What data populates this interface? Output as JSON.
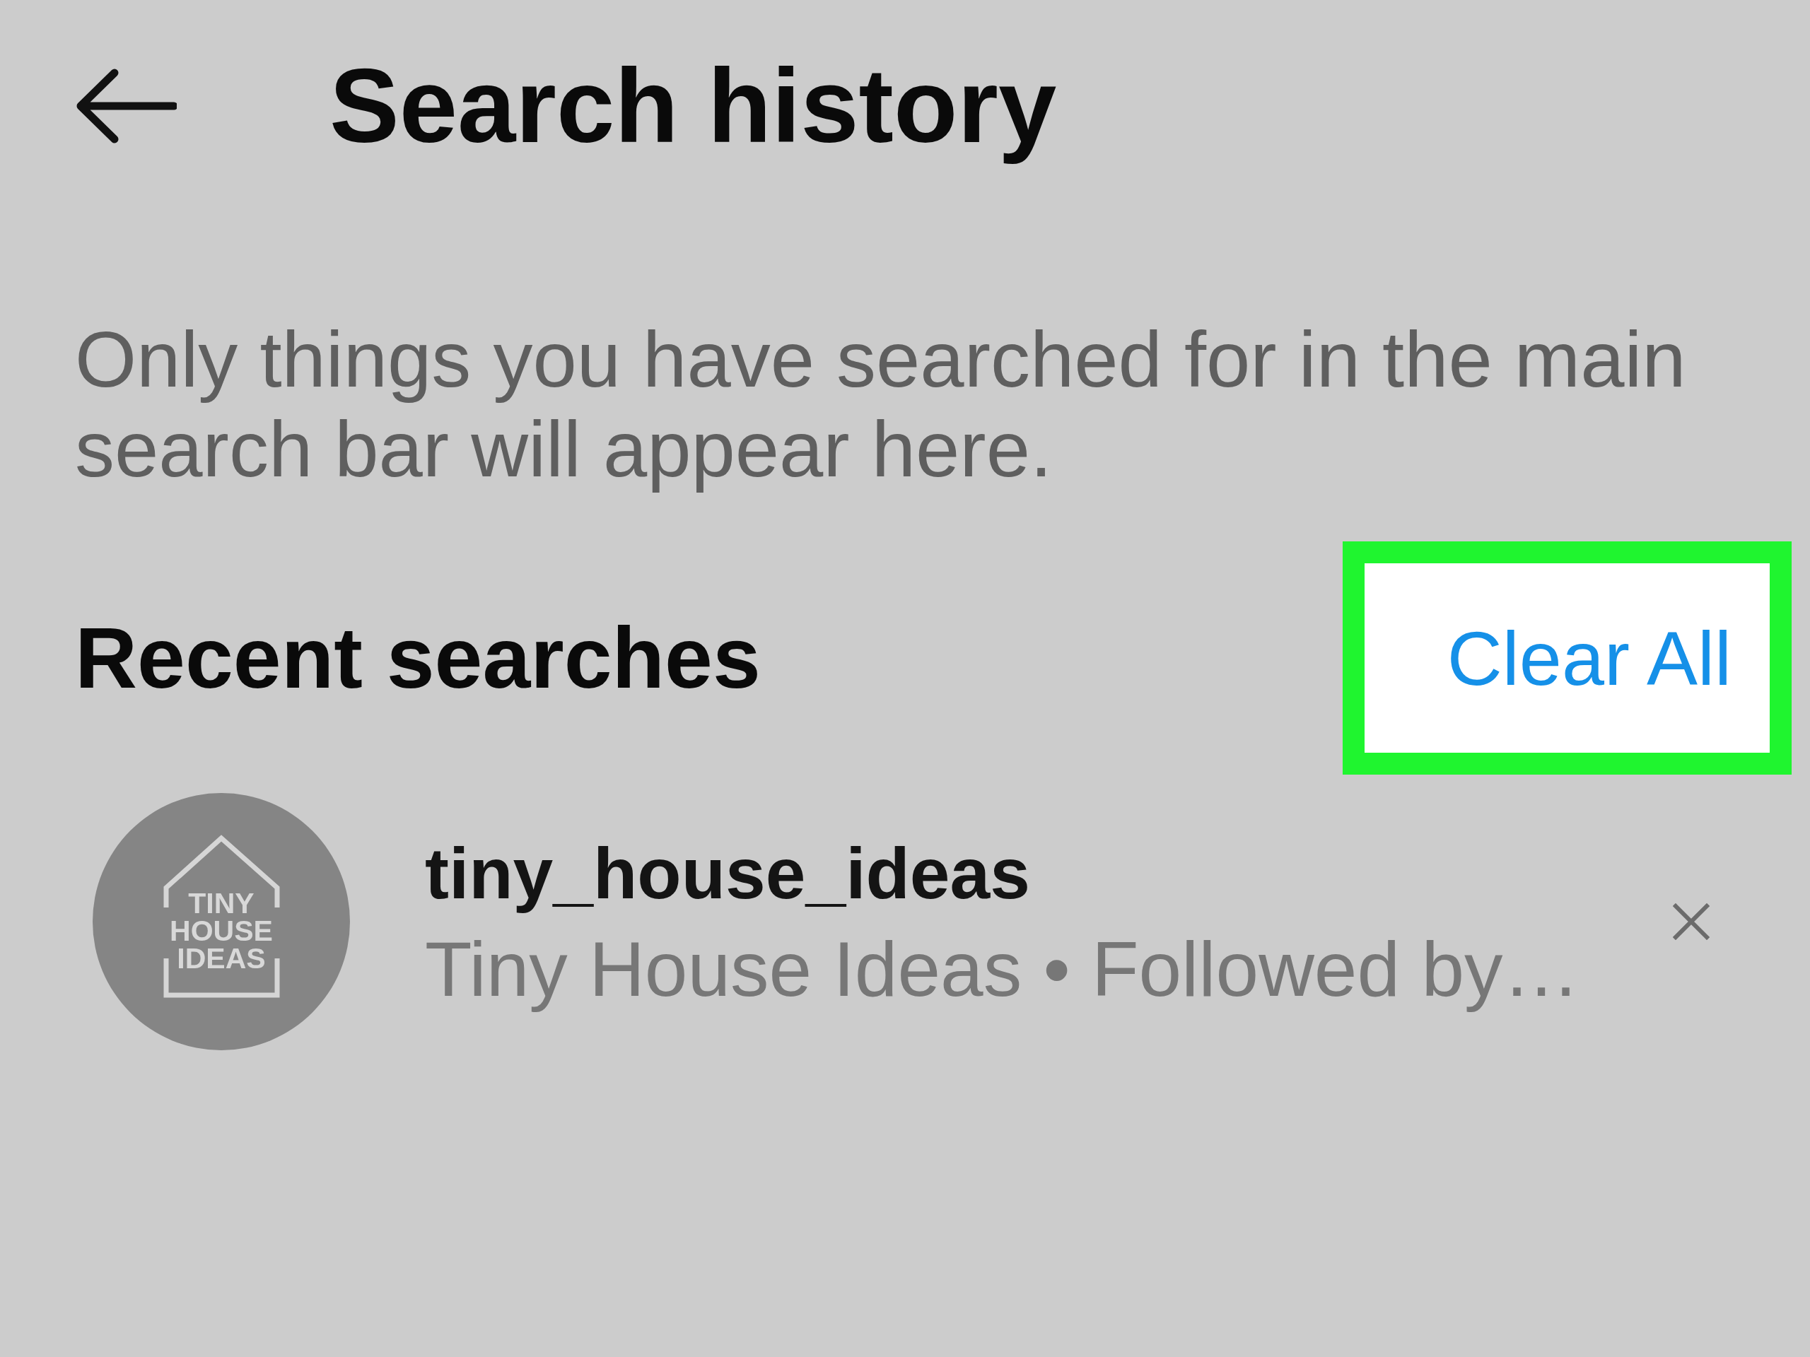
{
  "header": {
    "title": "Search history"
  },
  "description": "Only things you have searched for in the main search bar will appear here.",
  "recent_searches": {
    "heading": "Recent searches",
    "clear_all": {
      "label": "Clear All",
      "highlighted": true
    },
    "items": [
      {
        "username": "tiny_house_ideas",
        "subtitle": "Tiny House Ideas • Followed by…",
        "avatar_logo": "TINY HOUSE IDEAS"
      }
    ]
  }
}
